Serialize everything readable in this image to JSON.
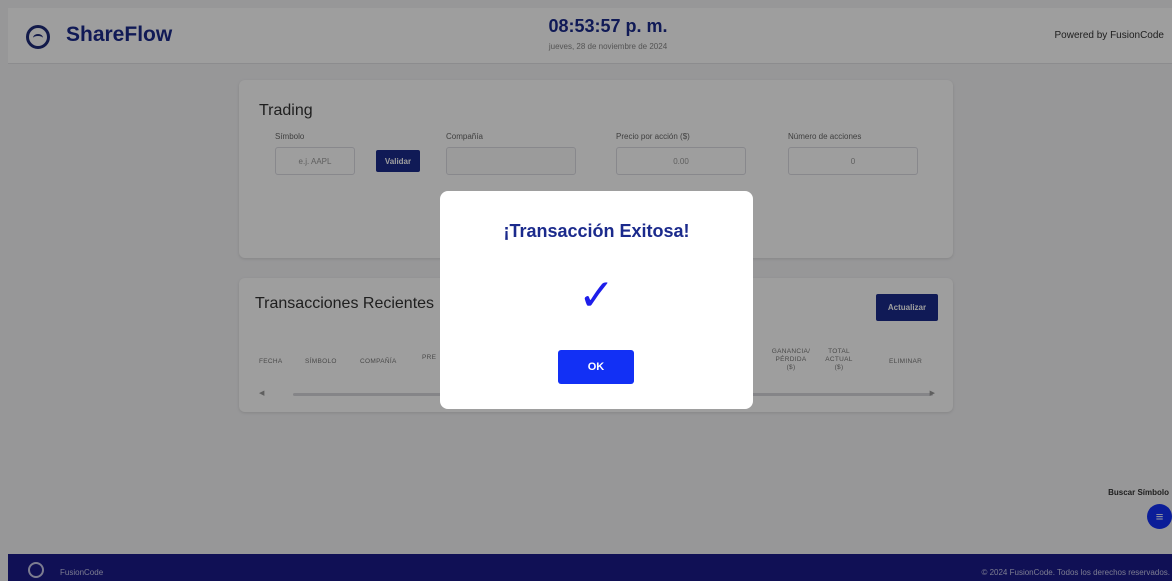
{
  "header": {
    "brand": "ShareFlow",
    "time": "08:53:57 p. m.",
    "date": "jueves, 28 de noviembre de 2024",
    "powered": "Powered by FusionCode"
  },
  "trading": {
    "title": "Trading",
    "symbol_label": "Símbolo",
    "symbol_placeholder": "e.j. AAPL",
    "validate_label": "Validar",
    "company_label": "Compañía",
    "company_value": "",
    "price_label": "Precio por acción ($)",
    "price_value": "0.00",
    "shares_label": "Número de acciones",
    "shares_value": "0"
  },
  "transactions": {
    "title": "Transacciones Recientes",
    "refresh_label": "Actualizar",
    "columns": {
      "fecha": "FECHA",
      "simbolo": "SÍMBOLO",
      "compania": "COMPAÑÍA",
      "precio": "PRE",
      "ganancia_1": "GANANCIA/",
      "ganancia_2": "PÉRDIDA",
      "ganancia_3": "($)",
      "total_1": "TOTAL",
      "total_2": "ACTUAL",
      "total_3": "($)",
      "eliminar": "ELIMINAR"
    }
  },
  "modal": {
    "title": "¡Transacción Exitosa!",
    "check": "✓",
    "ok_label": "OK"
  },
  "floating": {
    "search_label": "Buscar Símbolo",
    "menu_icon": "≡"
  },
  "footer": {
    "brand": "FusionCode",
    "copyright": "© 2024 FusionCode. Todos los derechos reservados."
  },
  "colors": {
    "primary": "#1b2a8c",
    "accent": "#1230f5",
    "footer": "#1a1a8a"
  }
}
